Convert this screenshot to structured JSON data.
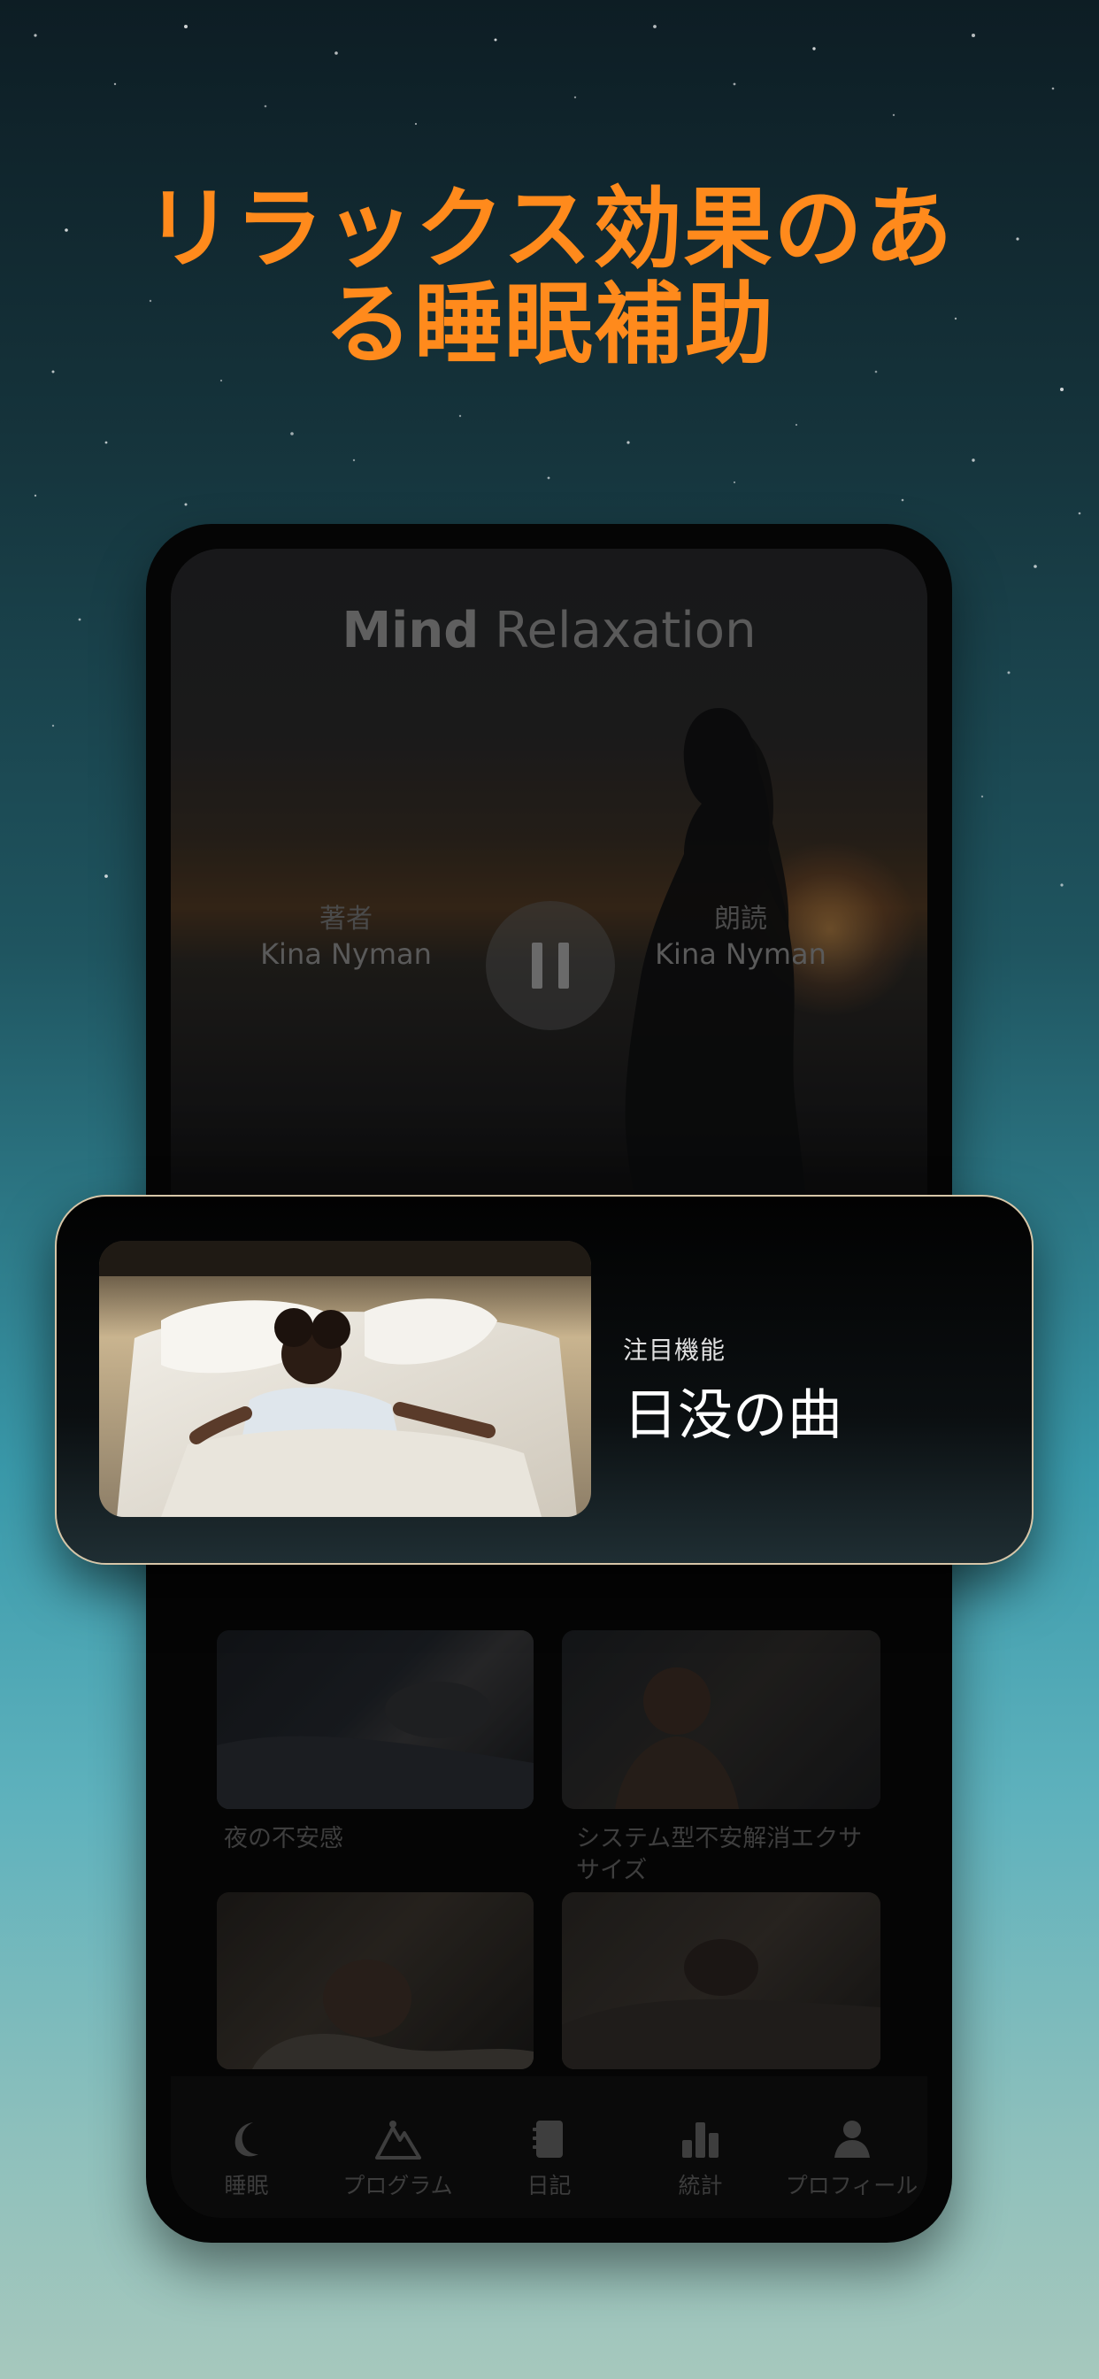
{
  "headline": {
    "line1": "リラックス効果のあ",
    "line2": "る睡眠補助",
    "color": "#ff8a1c"
  },
  "player": {
    "title_bold": "Mind",
    "title_rest": " Relaxation",
    "author_label": "著者",
    "author_name": "Kina Nyman",
    "narrator_label": "朗読",
    "narrator_name": "Kina Nyman",
    "control_icon": "pause-icon"
  },
  "featured": {
    "kicker": "注目機能",
    "title": "日没の曲",
    "border_color": "#d7c6a8"
  },
  "grid": {
    "items": [
      {
        "label": "夜の不安感"
      },
      {
        "label": "システム型不安解消エクササイズ"
      },
      {
        "label": ""
      },
      {
        "label": ""
      }
    ]
  },
  "tabbar": {
    "items": [
      {
        "label": "睡眠",
        "icon": "moon-icon"
      },
      {
        "label": "プログラム",
        "icon": "mountain-icon"
      },
      {
        "label": "日記",
        "icon": "journal-icon"
      },
      {
        "label": "統計",
        "icon": "bar-chart-icon"
      },
      {
        "label": "プロフィール",
        "icon": "user-icon"
      }
    ]
  }
}
